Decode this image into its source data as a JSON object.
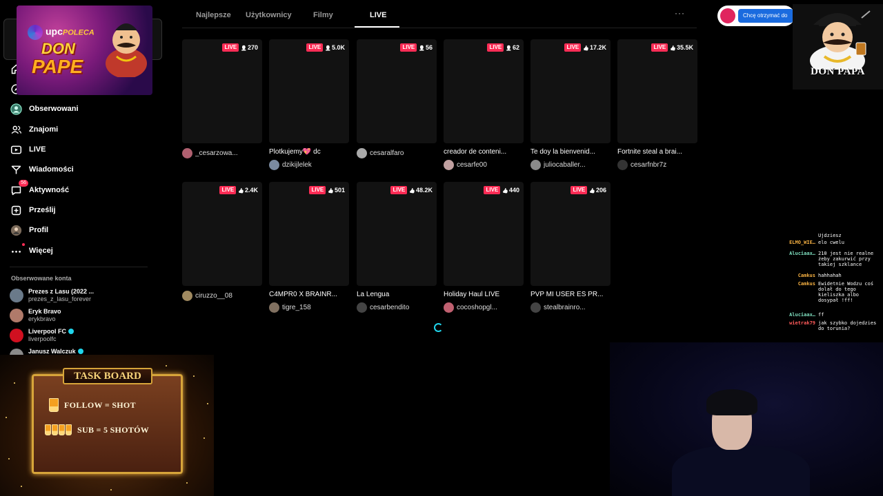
{
  "sidebar": {
    "items": [
      {
        "label": "",
        "icon": "home-icon"
      },
      {
        "label": "",
        "icon": "compass-icon"
      },
      {
        "label": "Obserwowani",
        "icon": "following-avatar-icon"
      },
      {
        "label": "Znajomi",
        "icon": "friends-icon"
      },
      {
        "label": "LIVE",
        "icon": "live-icon"
      },
      {
        "label": "Wiadomości",
        "icon": "messages-icon"
      },
      {
        "label": "Aktywność",
        "icon": "activity-icon",
        "badge": "56"
      },
      {
        "label": "Prześlij",
        "icon": "upload-icon"
      },
      {
        "label": "Profil",
        "icon": "profile-avatar-icon"
      },
      {
        "label": "Więcej",
        "icon": "more-icon"
      }
    ],
    "followed_title": "Obserwowane konta",
    "followed": [
      {
        "name": "Prezes z Lasu (2022 ...",
        "handle": "prezes_z_lasu_forever",
        "verified": false
      },
      {
        "name": "Eryk Bravo",
        "handle": "erykbravo",
        "verified": false
      },
      {
        "name": "Liverpool FC",
        "handle": "liverpoolfc",
        "verified": true
      },
      {
        "name": "Janusz Walczuk",
        "handle": "",
        "verified": true
      }
    ]
  },
  "tabs": [
    "Najlepsze",
    "Użytkownicy",
    "Filmy",
    "LIVE"
  ],
  "active_tab": "LIVE",
  "live_label": "LIVE",
  "cards": [
    {
      "viewers": "270",
      "metric": "viewers",
      "title": "",
      "author": "_cesarzowa..."
    },
    {
      "viewers": "5.0K",
      "metric": "viewers",
      "title": "Plotkujemy💖 dc",
      "author": "dzikijlelek"
    },
    {
      "viewers": "56",
      "metric": "viewers",
      "title": "",
      "author": "cesaralfaro"
    },
    {
      "viewers": "62",
      "metric": "viewers",
      "title": "creador de conteni...",
      "author": "cesarfe00"
    },
    {
      "viewers": "17.2K",
      "metric": "likes",
      "title": "Te doy la bienvenid...",
      "author": "juliocaballer..."
    },
    {
      "viewers": "35.5K",
      "metric": "likes",
      "title": "Fortnite steal a brai...",
      "author": "cesarfnbr7z"
    },
    {
      "viewers": "2.4K",
      "metric": "likes",
      "title": "",
      "author": "ciruzzo__08"
    },
    {
      "viewers": "501",
      "metric": "likes",
      "title": "C4MPR0 X BRAINR...",
      "author": "tigre_158"
    },
    {
      "viewers": "48.2K",
      "metric": "likes",
      "title": "La Lengua",
      "author": "cesarbendito"
    },
    {
      "viewers": "440",
      "metric": "likes",
      "title": "Holiday Haul LIVE",
      "author": "cocoshopgl..."
    },
    {
      "viewers": "206",
      "metric": "likes",
      "title": "PVP MI USER ES PR...",
      "author": "stealbrainro..."
    }
  ],
  "overlay": {
    "upc_brand": "upc",
    "upc_poleca": "POLECA",
    "upc_title1": "DON",
    "upc_title2": "PAPE",
    "notif_button": "Chcę otrzymać do",
    "donpapa": "DON PAPA",
    "chat": [
      {
        "user": "",
        "msg": "Ujdziesz",
        "color": "#ffffff"
      },
      {
        "user": "ELMO_WIE…",
        "msg": "elo cwelu",
        "color": "#f5b042"
      },
      {
        "user": "Aluciaax…",
        "msg": "210 jest nie realne żeby zakurwić przy takiej szklance",
        "color": "#7fe0c0"
      },
      {
        "user": "Camkus",
        "msg": "hahhahah",
        "color": "#f5b042"
      },
      {
        "user": "Camkus",
        "msg": "Ewidetnie Wodzu coś dolał do tego kieliszka albo dosypał !ff!",
        "color": "#f5b042"
      },
      {
        "user": "Aluciaax…",
        "msg": "ff",
        "color": "#7fe0c0"
      },
      {
        "user": "wietrak79",
        "msg": "jak szybko dojedzies do torunia?",
        "color": "#ff5a5a"
      }
    ],
    "taskboard_title": "TASK BOARD",
    "tasks": [
      "FOLLOW = SHOT",
      "SUB = 5 SHOTÓW"
    ]
  },
  "colors": {
    "accent": "#fe2c55",
    "bg": "#000000",
    "verified": "#20d5ec"
  }
}
